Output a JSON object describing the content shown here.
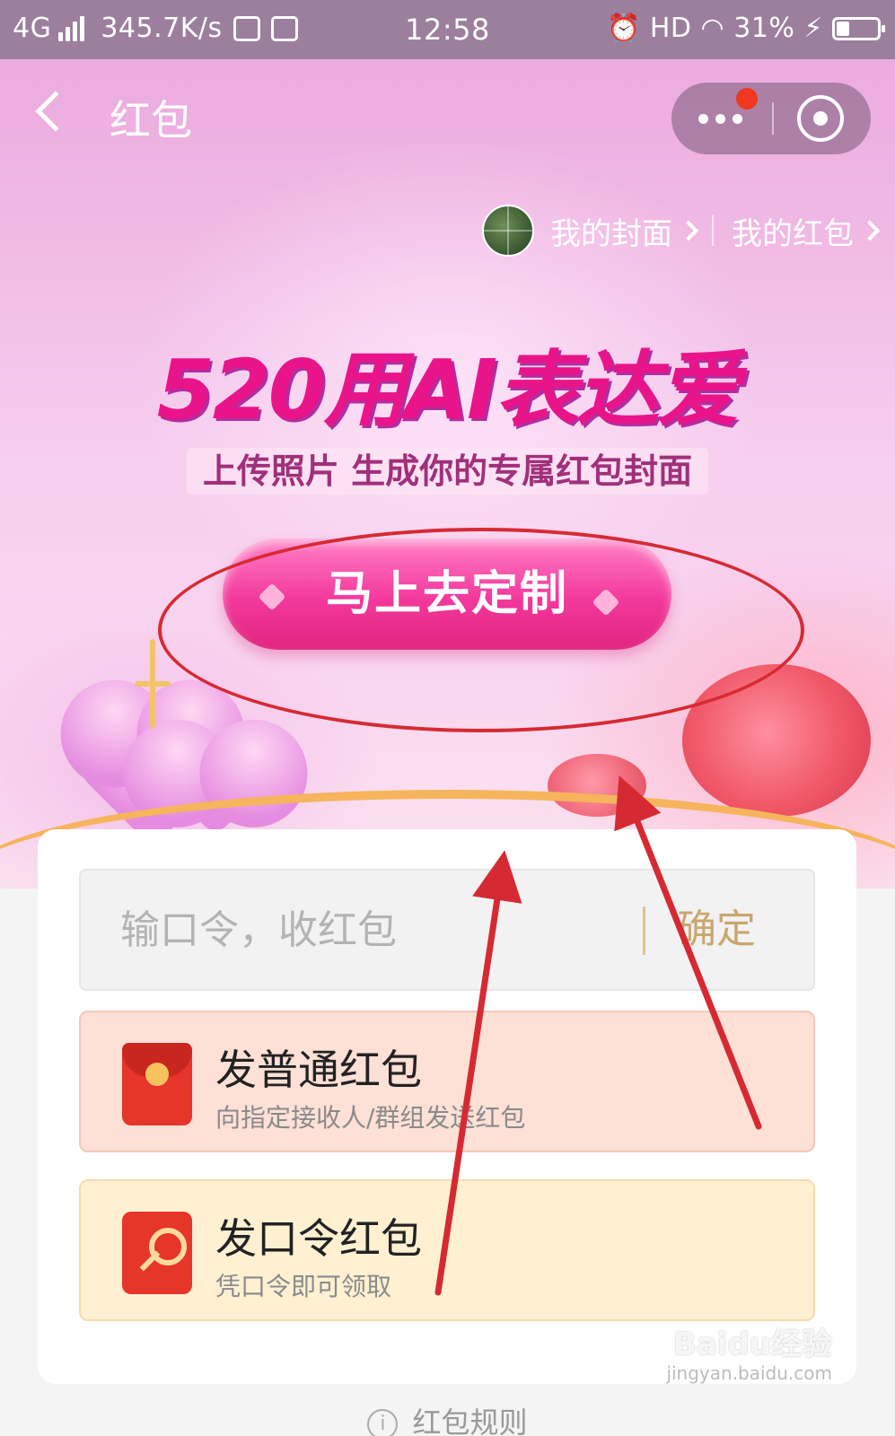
{
  "status_bar": {
    "network": "4G",
    "speed": "345.7K/s",
    "time": "12:58",
    "hd": "HD",
    "battery": "31%"
  },
  "nav": {
    "title": "红包"
  },
  "links": {
    "my_cover": "我的封面",
    "my_redpacket": "我的红包"
  },
  "promo": {
    "title": "520用AI表达爱",
    "subtitle": "上传照片 生成你的专属红包封面",
    "cta_label": "马上去定制"
  },
  "command_input": {
    "placeholder": "输口令，收红包",
    "confirm_label": "确定"
  },
  "options": [
    {
      "title": "发普通红包",
      "desc": "向指定接收人/群组发送红包",
      "icon": "red-envelope-icon"
    },
    {
      "title": "发口令红包",
      "desc": "凭口令即可领取",
      "icon": "key-icon"
    }
  ],
  "footer": {
    "rules_label": "红包规则"
  },
  "watermark": {
    "brand": "Baidu经验",
    "url": "jingyan.baidu.com"
  },
  "colors": {
    "accent": "#f3389c",
    "annotation": "#d62a33",
    "confirm": "#c9a66f"
  }
}
